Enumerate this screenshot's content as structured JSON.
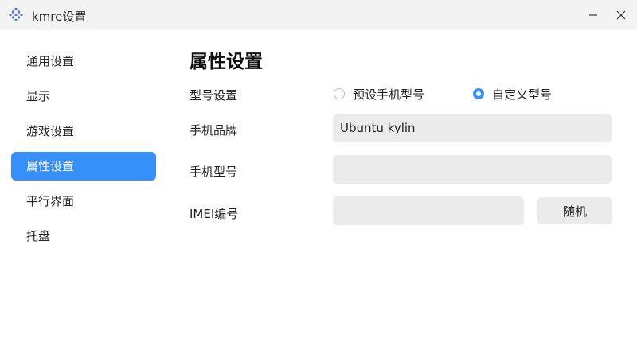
{
  "window": {
    "title": "kmre设置",
    "icon": "kmre-app-icon",
    "controls": {
      "minimize": "minimize-icon",
      "close": "close-icon"
    }
  },
  "sidebar": {
    "items": [
      {
        "label": "通用设置",
        "active": false
      },
      {
        "label": "显示",
        "active": false
      },
      {
        "label": "游戏设置",
        "active": false
      },
      {
        "label": "属性设置",
        "active": true
      },
      {
        "label": "平行界面",
        "active": false
      },
      {
        "label": "托盘",
        "active": false
      }
    ]
  },
  "main": {
    "title": "属性设置",
    "model_setting": {
      "label": "型号设置",
      "options": [
        {
          "label": "预设手机型号",
          "selected": false
        },
        {
          "label": "自定义型号",
          "selected": true
        }
      ]
    },
    "brand": {
      "label": "手机品牌",
      "value": "Ubuntu kylin"
    },
    "model": {
      "label": "手机型号",
      "value": ""
    },
    "imei": {
      "label": "IMEI编号",
      "value": "",
      "button_label": "随机"
    }
  },
  "colors": {
    "accent": "#3790fa",
    "field_background": "#ebebeb",
    "titlebar_background": "#f3f3f3"
  }
}
